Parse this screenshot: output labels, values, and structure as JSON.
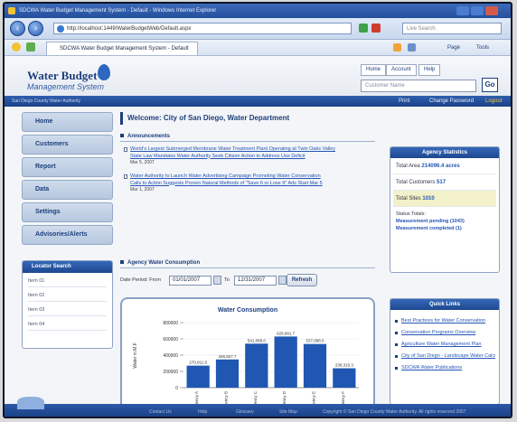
{
  "browser": {
    "title": "SDCWA Water Budget Management System - Default - Windows Internet Explorer",
    "url": "http://localhost:1449/WaterBudgetWeb/Default.aspx",
    "tab_label": "SDCWA Water Budget Management System - Default",
    "search_placeholder": "Live Search",
    "page_cmd": "Page",
    "tools_cmd": "Tools"
  },
  "site": {
    "logo_line1": "Water Budget",
    "logo_line2": "Management System",
    "top_tabs": [
      "Home",
      "Account",
      "Help"
    ],
    "search_placeholder": "Customer Name",
    "go_label": "Go",
    "breadcrumb": "San Diego County Water Authority",
    "bar_links": [
      "Print",
      "Change Password",
      "Logout"
    ]
  },
  "nav": {
    "items": [
      "Home",
      "Customers",
      "Report",
      "Data",
      "Settings",
      "Advisories/Alerts"
    ]
  },
  "quick_search": {
    "title": "Locator Search",
    "items": [
      "Item 01",
      "Item 02",
      "Item 03",
      "Item 04"
    ]
  },
  "main": {
    "welcome": "Welcome: City of San Diego, Water Department",
    "announcements_title": "Announcements",
    "announcements": [
      {
        "line1": "World's Largest Submerged Membrane Water Treatment Plant Operating at Twin Oaks Valley",
        "line2": "State Law Mandates Water Authority Seek Citizen Action to Address Use Deficit",
        "date": "Mar 5, 2007"
      },
      {
        "line1": "Water Authority to Launch Water Advertising Campaign Promoting Water Conservation",
        "line2": "Calls to Action Suggests Proven Natural Methods of \"Save It or Lose It\" Ads Start Mar 5",
        "date": "Mar 1, 2007"
      }
    ],
    "consumption_title": "Agency Water Consumption",
    "date_label": "Date Period: From",
    "from_date": "01/01/2007",
    "to_label": "To",
    "to_date": "12/31/2007",
    "refresh_label": "Refresh"
  },
  "stats": {
    "title": "Agency Statistics",
    "total_area_label": "Total Area",
    "total_area_value": "214096.4 acres",
    "total_customers_label": "Total Customers",
    "total_customers_value": "517",
    "total_sites_label": "Total Sites",
    "total_sites_value": "1010",
    "status_label": "Status Totals:",
    "status_line1": "Measurement pending (1043)",
    "status_line2": "Measurement completed (1)"
  },
  "quick_links": {
    "title": "Quick Links",
    "items": [
      "Best Practices for Water Conservation",
      "Conservation Programs Overview",
      "Agriculture Water Management Plan",
      "City of San Diego - Landscape Water Calculator",
      "SDCWA Water Publications"
    ]
  },
  "footer": {
    "links": [
      "Contact Us",
      "Help",
      "Glossary",
      "Site Map"
    ],
    "copyright": "Copyright © San Diego County Water Authority. All rights reserved 2007"
  },
  "chart_data": {
    "type": "bar",
    "title": "Water Consumption",
    "ylabel": "Water in M.F.",
    "xlabel": "",
    "categories": [
      "Agency A",
      "Agency B",
      "Agency C",
      "Agency D",
      "Agency E",
      "Agency F"
    ],
    "values": [
      270811,
      346827,
      541088,
      628981,
      537088,
      238310
    ],
    "value_labels": [
      "270,811.6",
      "346,827.7",
      "541,088.0",
      "628,981.7",
      "537,088.0",
      "238,310.3"
    ],
    "ylim": [
      0,
      800000
    ],
    "yticks": [
      "800000",
      "600000",
      "400000",
      "200000",
      "0"
    ],
    "legend": [
      "Water Consumption"
    ],
    "legend_position": "bottom",
    "colors": {
      "bar": "#1f57b3"
    }
  }
}
